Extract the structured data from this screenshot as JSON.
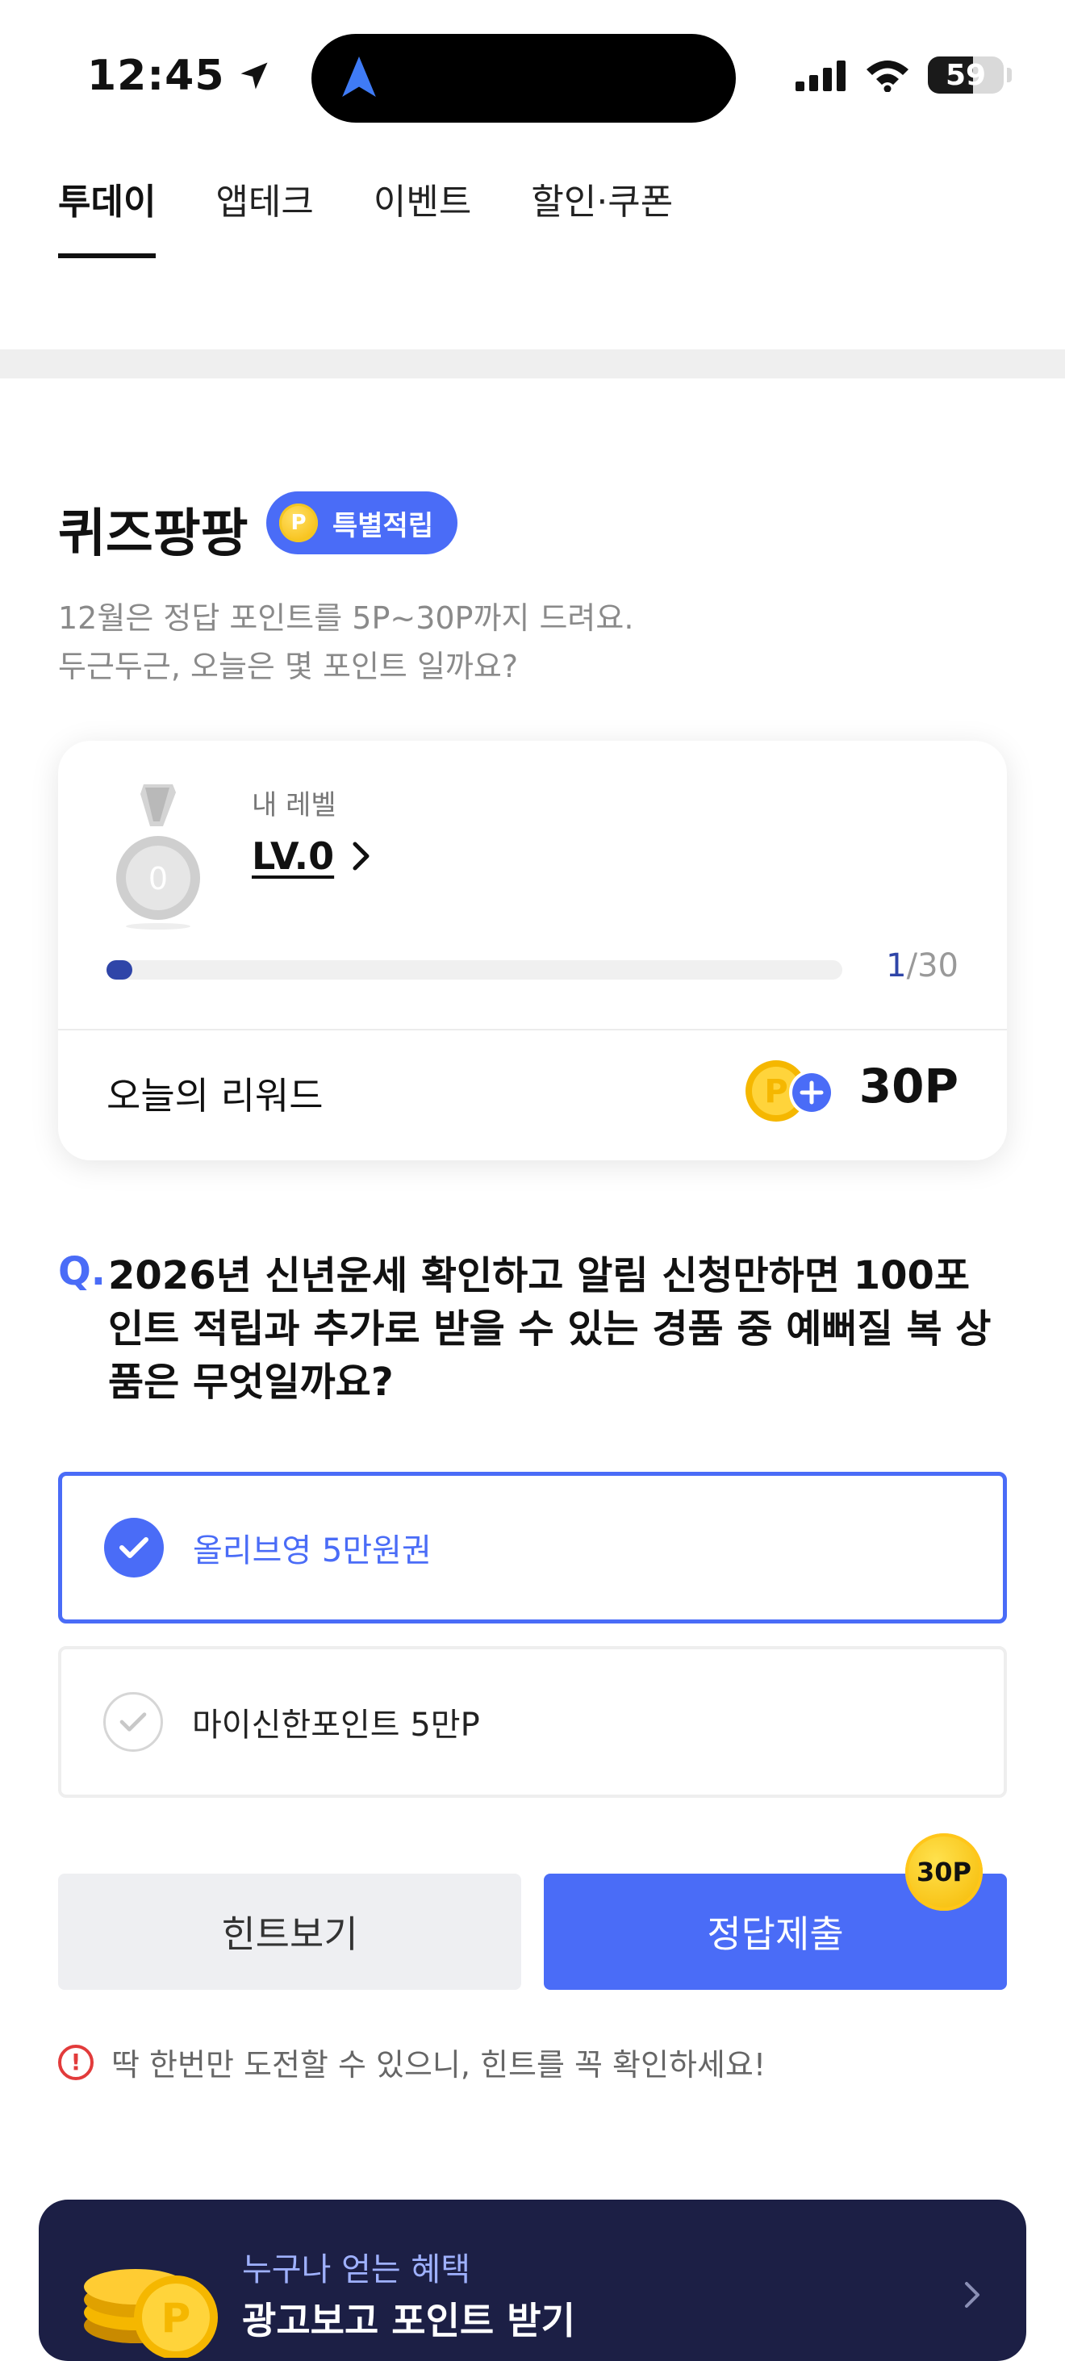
{
  "status_bar": {
    "time": "12:45",
    "battery": "59"
  },
  "tabs": [
    {
      "label": "투데이",
      "active": true
    },
    {
      "label": "앱테크",
      "active": false
    },
    {
      "label": "이벤트",
      "active": false
    },
    {
      "label": "할인·쿠폰",
      "active": false
    }
  ],
  "quiz": {
    "title": "퀴즈팡팡",
    "badge": "특별적립",
    "badge_coin": "P",
    "desc_line1": "12월은 정답 포인트를 5P~30P까지 드려요.",
    "desc_line2": "두근두근, 오늘은 몇 포인트 일까요?"
  },
  "level_card": {
    "medal_number": "0",
    "label": "내 레벨",
    "value": "LV.0",
    "progress_current": "1",
    "progress_total": "/30",
    "progress_fraction": 0.033,
    "reward_label": "오늘의 리워드",
    "reward_value": "30P"
  },
  "question": {
    "mark": "Q.",
    "text": "2026년 신년운세 확인하고 알림 신청만하면 100포인트 적립과 추가로 받을 수 있는 경품 중 예뻐질 복 상품은 무엇일까요?",
    "options": [
      {
        "label": "올리브영 5만원권",
        "selected": true
      },
      {
        "label": "마이신한포인트 5만P",
        "selected": false
      }
    ]
  },
  "actions": {
    "hint_label": "힌트보기",
    "submit_label": "정답제출",
    "submit_badge": "30P"
  },
  "warning": {
    "icon": "!",
    "text": "딱 한번만 도전할 수 있으니, 힌트를 꼭 확인하세요!"
  },
  "banner": {
    "sub": "누구나 얻는 혜택",
    "main": "광고보고 포인트 받기",
    "coin_letter": "P"
  },
  "colors": {
    "accent": "#4a6cf7",
    "navy": "#2f45a8",
    "banner_bg": "#1c1f45",
    "coin": "#f5b700",
    "warning": "#e23b3b"
  }
}
